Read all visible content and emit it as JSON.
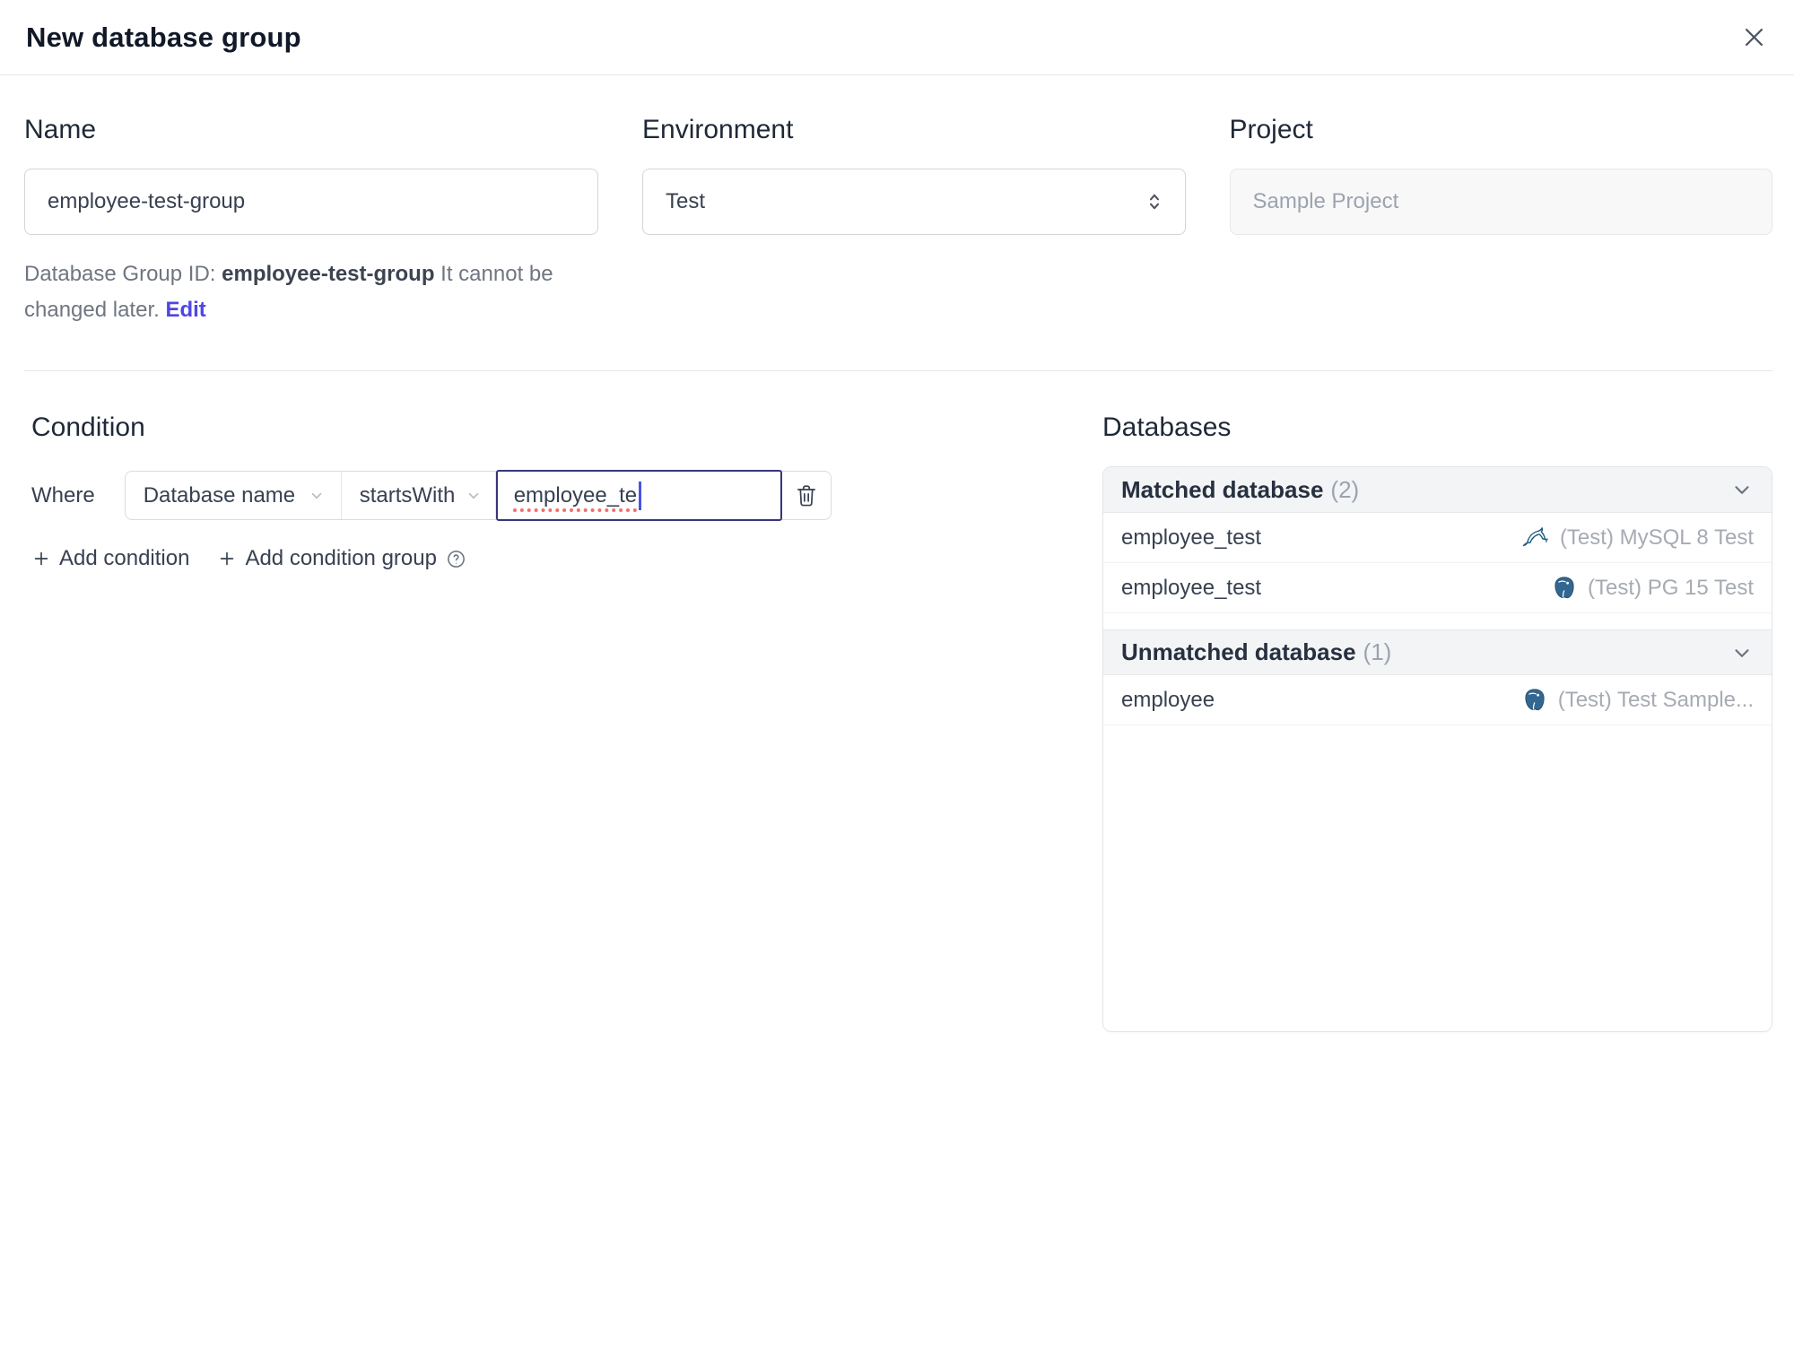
{
  "dialog": {
    "title": "New database group"
  },
  "form": {
    "name": {
      "label": "Name",
      "value": "employee-test-group"
    },
    "environment": {
      "label": "Environment",
      "value": "Test"
    },
    "project": {
      "label": "Project",
      "value": "Sample Project"
    },
    "group_id_note": {
      "prefix": "Database Group ID: ",
      "id": "employee-test-group",
      "suffix": " It cannot be changed later. ",
      "edit_label": "Edit"
    }
  },
  "condition": {
    "heading": "Condition",
    "where_label": "Where",
    "field_selector": "Database name",
    "operator_selector": "startsWith",
    "value_input": "employee_te",
    "add_condition_label": "Add condition",
    "add_condition_group_label": "Add condition group"
  },
  "databases": {
    "heading": "Databases",
    "sections": [
      {
        "title": "Matched database",
        "count": "(2)",
        "rows": [
          {
            "name": "employee_test",
            "engine": "mysql",
            "instance": "(Test) MySQL 8 Test"
          },
          {
            "name": "employee_test",
            "engine": "postgres",
            "instance": "(Test) PG 15 Test"
          }
        ]
      },
      {
        "title": "Unmatched database",
        "count": "(1)",
        "rows": [
          {
            "name": "employee",
            "engine": "postgres",
            "instance": "(Test) Test Sample..."
          }
        ]
      }
    ]
  },
  "colors": {
    "accent": "#4f46e5",
    "focus_border": "#38357e",
    "spellcheck_underline": "#f0716c",
    "mysql_icon": "#1b5a7d",
    "postgres_icon": "#336791",
    "section_header_bg": "#f3f4f6"
  }
}
